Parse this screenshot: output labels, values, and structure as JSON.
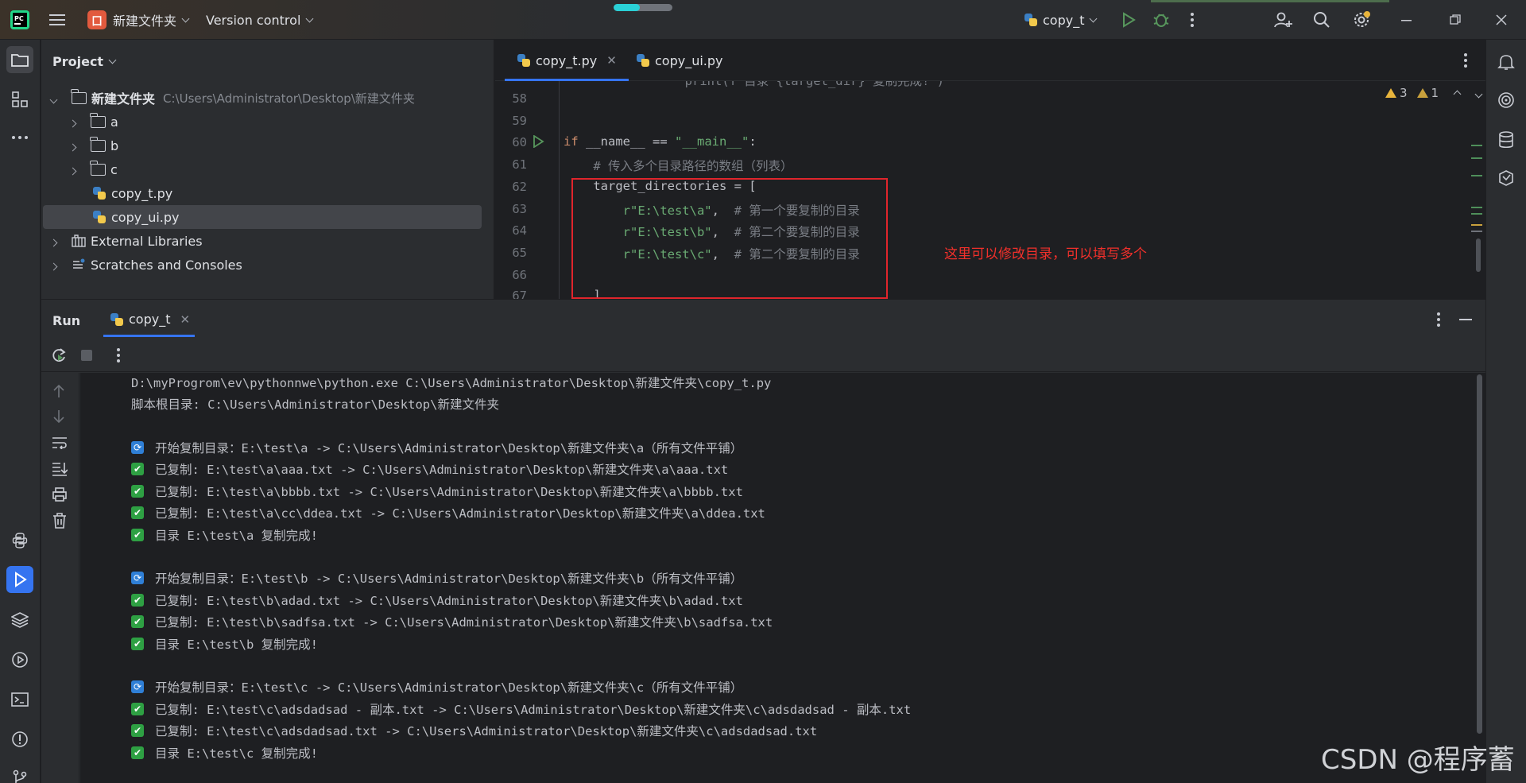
{
  "titlebar": {
    "project_name": "新建文件夹",
    "project_badge": "囗",
    "vcs_label": "Version control",
    "run_config": "copy_t",
    "background_task_progress": 0.45
  },
  "left_strip": {
    "items": [
      "project-tool",
      "structure-tool",
      "more-tools",
      "python-packages",
      "run-tool",
      "layers",
      "services",
      "terminal",
      "problems",
      "git"
    ]
  },
  "project": {
    "title": "Project",
    "tree": [
      {
        "label": "新建文件夹",
        "path": "C:\\Users\\Administrator\\Desktop\\新建文件夹",
        "kind": "folder-open"
      },
      {
        "label": "a",
        "kind": "folder"
      },
      {
        "label": "b",
        "kind": "folder"
      },
      {
        "label": "c",
        "kind": "folder"
      },
      {
        "label": "copy_t.py",
        "kind": "python"
      },
      {
        "label": "copy_ui.py",
        "kind": "python"
      },
      {
        "label": "External Libraries",
        "kind": "library"
      },
      {
        "label": "Scratches and Consoles",
        "kind": "scratch"
      }
    ]
  },
  "editor": {
    "tabs": [
      {
        "label": "copy_t.py",
        "active": true
      },
      {
        "label": "copy_ui.py",
        "active": false
      }
    ],
    "warnings": "3",
    "weak_warnings": "1",
    "lines": [
      {
        "num": "58",
        "code": ""
      },
      {
        "num": "59",
        "code": ""
      },
      {
        "num": "60",
        "code": "if __name__ == \"__main__\":"
      },
      {
        "num": "61",
        "code": "    # 传入多个目录路径的数组（列表）"
      },
      {
        "num": "62",
        "code": "    target_directories = ["
      },
      {
        "num": "63",
        "code": "        r\"E:\\test\\a\",  # 第一个要复制的目录"
      },
      {
        "num": "64",
        "code": "        r\"E:\\test\\b\",  # 第二个要复制的目录"
      },
      {
        "num": "65",
        "code": "        r\"E:\\test\\c\",  # 第二个要复制的目录"
      },
      {
        "num": "66",
        "code": ""
      },
      {
        "num": "67",
        "code": "    ]"
      }
    ],
    "annotation": "这里可以修改目录，可以填写多个"
  },
  "run": {
    "title": "Run",
    "tab_label": "copy_t",
    "console": [
      {
        "icon": "none",
        "text": "D:\\myProgrom\\ev\\pythonnwe\\python.exe C:\\Users\\Administrator\\Desktop\\新建文件夹\\copy_t.py"
      },
      {
        "icon": "none",
        "text": "脚本根目录: C:\\Users\\Administrator\\Desktop\\新建文件夹"
      },
      {
        "icon": "blank",
        "text": ""
      },
      {
        "icon": "sync",
        "text": "开始复制目录：E:\\test\\a -> C:\\Users\\Administrator\\Desktop\\新建文件夹\\a（所有文件平铺）"
      },
      {
        "icon": "check",
        "text": "已复制: E:\\test\\a\\aaa.txt -> C:\\Users\\Administrator\\Desktop\\新建文件夹\\a\\aaa.txt"
      },
      {
        "icon": "check",
        "text": "已复制: E:\\test\\a\\bbbb.txt -> C:\\Users\\Administrator\\Desktop\\新建文件夹\\a\\bbbb.txt"
      },
      {
        "icon": "check",
        "text": "已复制: E:\\test\\a\\cc\\ddea.txt -> C:\\Users\\Administrator\\Desktop\\新建文件夹\\a\\ddea.txt"
      },
      {
        "icon": "check",
        "text": "目录 E:\\test\\a 复制完成!"
      },
      {
        "icon": "blank",
        "text": ""
      },
      {
        "icon": "sync",
        "text": "开始复制目录：E:\\test\\b -> C:\\Users\\Administrator\\Desktop\\新建文件夹\\b（所有文件平铺）"
      },
      {
        "icon": "check",
        "text": "已复制: E:\\test\\b\\adad.txt -> C:\\Users\\Administrator\\Desktop\\新建文件夹\\b\\adad.txt"
      },
      {
        "icon": "check",
        "text": "已复制: E:\\test\\b\\sadfsa.txt -> C:\\Users\\Administrator\\Desktop\\新建文件夹\\b\\sadfsa.txt"
      },
      {
        "icon": "check",
        "text": "目录 E:\\test\\b 复制完成!"
      },
      {
        "icon": "blank",
        "text": ""
      },
      {
        "icon": "sync",
        "text": "开始复制目录：E:\\test\\c -> C:\\Users\\Administrator\\Desktop\\新建文件夹\\c（所有文件平铺）"
      },
      {
        "icon": "check",
        "text": "已复制: E:\\test\\c\\adsdadsad - 副本.txt -> C:\\Users\\Administrator\\Desktop\\新建文件夹\\c\\adsdadsad - 副本.txt"
      },
      {
        "icon": "check",
        "text": "已复制: E:\\test\\c\\adsdadsad.txt -> C:\\Users\\Administrator\\Desktop\\新建文件夹\\c\\adsdadsad.txt"
      },
      {
        "icon": "check",
        "text": "目录 E:\\test\\c 复制完成!"
      }
    ]
  },
  "watermark": "CSDN @程序蓄",
  "colors": {
    "accent": "#3574f0",
    "keyword": "#cf8e6d",
    "string": "#6aab73",
    "comment": "#7a7e85",
    "annotation_red": "#e0252c",
    "check_green": "#2ea043"
  }
}
